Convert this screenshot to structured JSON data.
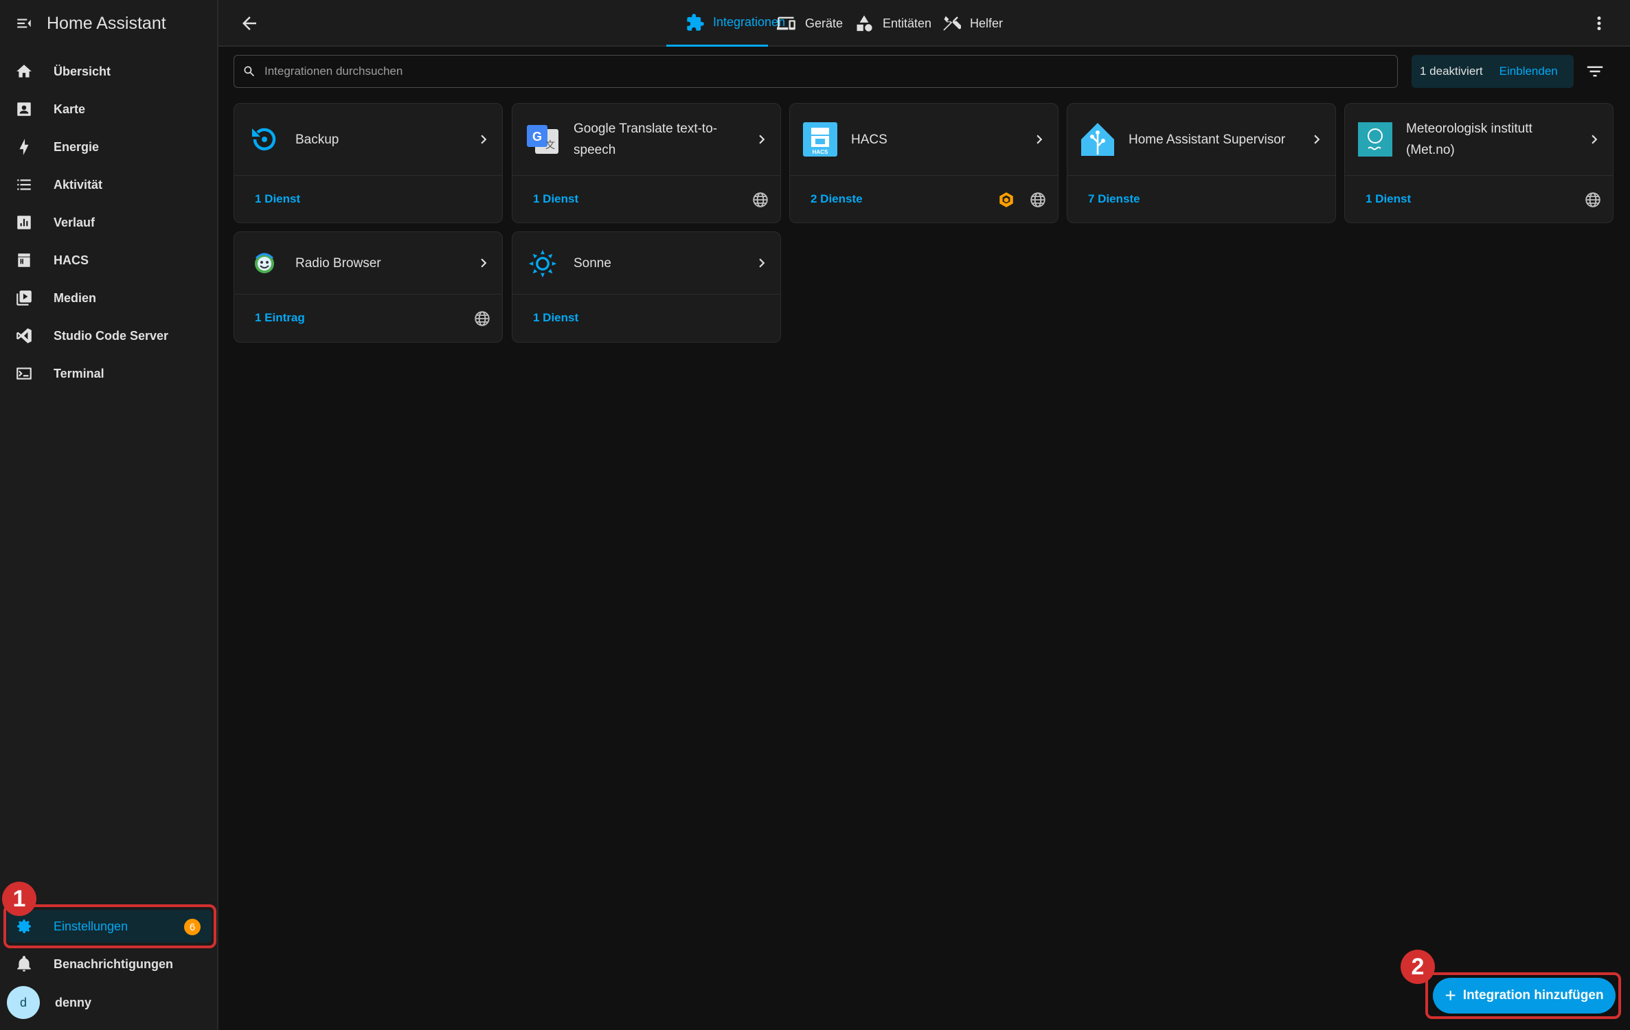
{
  "app": {
    "title": "Home Assistant"
  },
  "sidebar": {
    "items": [
      {
        "label": "Übersicht",
        "icon": "home-icon"
      },
      {
        "label": "Karte",
        "icon": "map-account-icon"
      },
      {
        "label": "Energie",
        "icon": "lightning-bolt-icon"
      },
      {
        "label": "Aktivität",
        "icon": "format-list-icon"
      },
      {
        "label": "Verlauf",
        "icon": "chart-box-icon"
      },
      {
        "label": "HACS",
        "icon": "hacs-icon"
      },
      {
        "label": "Medien",
        "icon": "play-box-multiple-icon"
      },
      {
        "label": "Studio Code Server",
        "icon": "vscode-icon"
      },
      {
        "label": "Terminal",
        "icon": "console-icon"
      }
    ],
    "settings": {
      "label": "Einstellungen",
      "badge": "6",
      "icon": "cog-icon"
    },
    "notifications": {
      "label": "Benachrichtigungen",
      "icon": "bell-icon"
    },
    "user": {
      "name": "denny",
      "initial": "d"
    }
  },
  "tabs": [
    {
      "label": "Integrationen",
      "icon": "puzzle-icon",
      "active": true
    },
    {
      "label": "Geräte",
      "icon": "devices-icon"
    },
    {
      "label": "Entitäten",
      "icon": "shape-icon"
    },
    {
      "label": "Helfer",
      "icon": "tools-icon"
    }
  ],
  "search": {
    "placeholder": "Integrationen durchsuchen",
    "value": ""
  },
  "disabled_filter": {
    "text": "1 deaktiviert",
    "action": "Einblenden"
  },
  "integrations": [
    {
      "name": "Backup",
      "link": "1 Dienst",
      "logo": "backup-icon",
      "cloud": false
    },
    {
      "name": "Google Translate text-to-speech",
      "link": "1 Dienst",
      "logo": "google-translate-icon",
      "cloud": true
    },
    {
      "name": "HACS",
      "link": "2 Dienste",
      "logo": "hacs-logo-icon",
      "cloud": true,
      "custom": true
    },
    {
      "name": "Home Assistant Supervisor",
      "link": "7 Dienste",
      "logo": "home-assistant-supervisor-icon",
      "cloud": false
    },
    {
      "name": "Meteorologisk institutt (Met.no)",
      "link": "1 Dienst",
      "logo": "met-no-icon",
      "cloud": true
    },
    {
      "name": "Radio Browser",
      "link": "1 Eintrag",
      "logo": "radio-browser-icon",
      "cloud": true
    },
    {
      "name": "Sonne",
      "link": "1 Dienst",
      "logo": "sun-icon",
      "cloud": false
    }
  ],
  "fab": {
    "label": "Integration hinzufügen"
  },
  "annotations": [
    "1",
    "2"
  ],
  "colors": {
    "accent": "#03a9f4",
    "badge": "#ff9800",
    "annotation": "#d32f2f",
    "background": "#111111",
    "card": "#1c1c1c"
  }
}
